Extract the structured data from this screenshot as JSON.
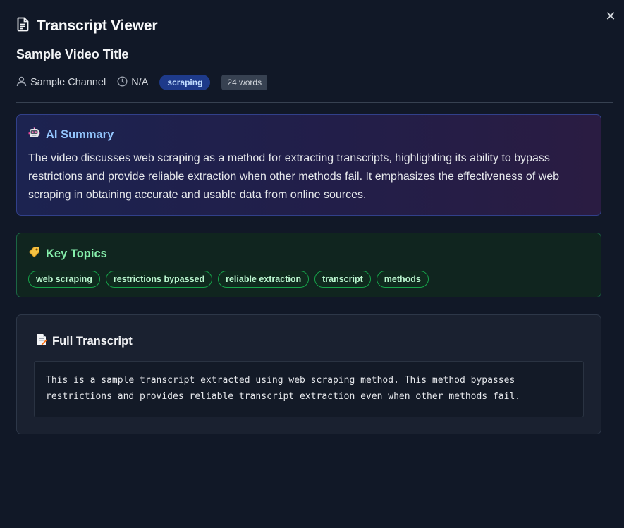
{
  "window": {
    "title": "Transcript Viewer",
    "close_glyph": "✕"
  },
  "video": {
    "title": "Sample Video Title",
    "channel": "Sample Channel",
    "duration": "N/A",
    "tag": "scraping",
    "word_count": "24 words"
  },
  "summary": {
    "title": "AI Summary",
    "icon": "robot-icon",
    "text": "The video discusses web scraping as a method for extracting transcripts, highlighting its ability to bypass restrictions and provide reliable extraction when other methods fail. It emphasizes the effectiveness of web scraping in obtaining accurate and usable data from online sources."
  },
  "topics": {
    "title": "Key Topics",
    "icon": "tag-icon",
    "items": [
      "web scraping",
      "restrictions bypassed",
      "reliable extraction",
      "transcript",
      "methods"
    ]
  },
  "transcript": {
    "title": "Full Transcript",
    "icon": "document-icon",
    "text": "This is a sample transcript extracted using web scraping method. This method bypasses restrictions and provides reliable transcript extraction even when other methods fail."
  },
  "colors": {
    "background": "#111827",
    "summary_accent": "#93c5fd",
    "topics_accent": "#86efac",
    "tag_badge": "#1e3a8a"
  }
}
